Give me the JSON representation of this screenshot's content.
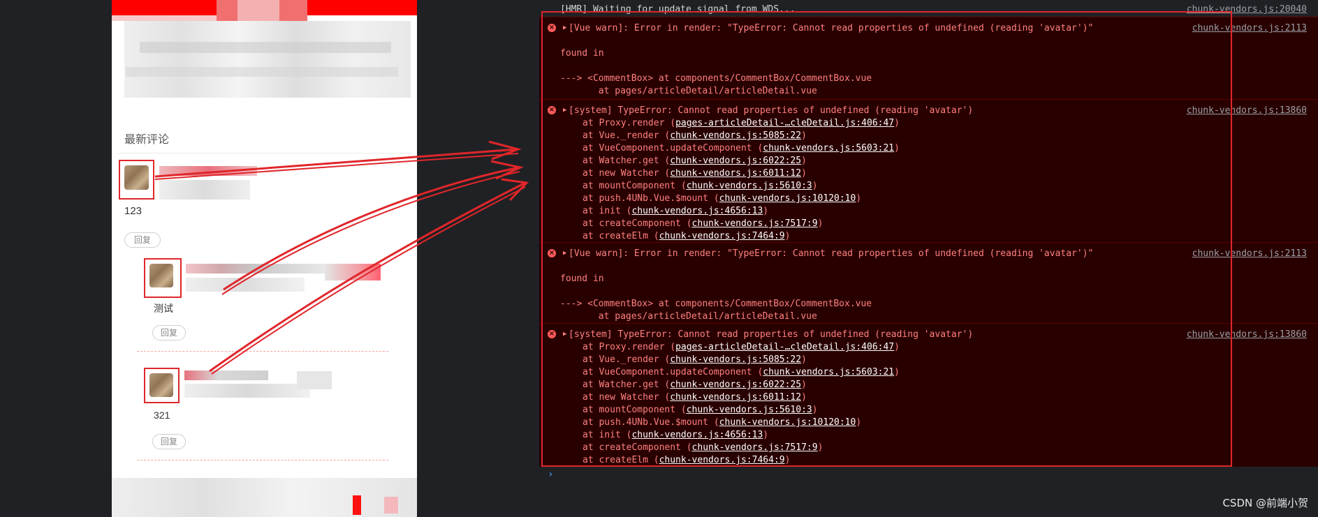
{
  "phone": {
    "section_title": "最新评论",
    "comments": [
      {
        "name": "123",
        "reply_label": "回复"
      },
      {
        "name": "测试",
        "reply_label": "回复"
      },
      {
        "name": "321",
        "reply_label": "回复"
      }
    ]
  },
  "console": {
    "hmr_line": "[HMR] Waiting for update signal from WDS...",
    "hmr_source": "chunk-vendors.js:20040",
    "errors": [
      {
        "kind": "vue",
        "message": "[Vue warn]: Error in render: \"TypeError: Cannot read properties of undefined (reading 'avatar')\"",
        "source": "chunk-vendors.js:2113",
        "found_in": "found in",
        "trace1": "---> <CommentBox> at components/CommentBox/CommentBox.vue",
        "trace2": "       at pages/articleDetail/articleDetail.vue"
      },
      {
        "kind": "system",
        "message": "[system] TypeError: Cannot read properties of undefined (reading 'avatar')",
        "source": "chunk-vendors.js:13860",
        "frames": [
          {
            "fn": "at Proxy.render (",
            "link": "pages-articleDetail-…cleDetail.js:406:47",
            "end": ")"
          },
          {
            "fn": "at Vue._render (",
            "link": "chunk-vendors.js:5085:22",
            "end": ")"
          },
          {
            "fn": "at VueComponent.updateComponent (",
            "link": "chunk-vendors.js:5603:21",
            "end": ")"
          },
          {
            "fn": "at Watcher.get (",
            "link": "chunk-vendors.js:6022:25",
            "end": ")"
          },
          {
            "fn": "at new Watcher (",
            "link": "chunk-vendors.js:6011:12",
            "end": ")"
          },
          {
            "fn": "at mountComponent (",
            "link": "chunk-vendors.js:5610:3",
            "end": ")"
          },
          {
            "fn": "at push.4UNb.Vue.$mount (",
            "link": "chunk-vendors.js:10120:10",
            "end": ")"
          },
          {
            "fn": "at init (",
            "link": "chunk-vendors.js:4656:13",
            "end": ")"
          },
          {
            "fn": "at createComponent (",
            "link": "chunk-vendors.js:7517:9",
            "end": ")"
          },
          {
            "fn": "at createElm (",
            "link": "chunk-vendors.js:7464:9",
            "end": ")"
          }
        ]
      },
      {
        "kind": "vue",
        "message": "[Vue warn]: Error in render: \"TypeError: Cannot read properties of undefined (reading 'avatar')\"",
        "source": "chunk-vendors.js:2113",
        "found_in": "found in",
        "trace1": "---> <CommentBox> at components/CommentBox/CommentBox.vue",
        "trace2": "       at pages/articleDetail/articleDetail.vue"
      },
      {
        "kind": "system",
        "message": "[system] TypeError: Cannot read properties of undefined (reading 'avatar')",
        "source": "chunk-vendors.js:13860",
        "frames": [
          {
            "fn": "at Proxy.render (",
            "link": "pages-articleDetail-…cleDetail.js:406:47",
            "end": ")"
          },
          {
            "fn": "at Vue._render (",
            "link": "chunk-vendors.js:5085:22",
            "end": ")"
          },
          {
            "fn": "at VueComponent.updateComponent (",
            "link": "chunk-vendors.js:5603:21",
            "end": ")"
          },
          {
            "fn": "at Watcher.get (",
            "link": "chunk-vendors.js:6022:25",
            "end": ")"
          },
          {
            "fn": "at new Watcher (",
            "link": "chunk-vendors.js:6011:12",
            "end": ")"
          },
          {
            "fn": "at mountComponent (",
            "link": "chunk-vendors.js:5610:3",
            "end": ")"
          },
          {
            "fn": "at push.4UNb.Vue.$mount (",
            "link": "chunk-vendors.js:10120:10",
            "end": ")"
          },
          {
            "fn": "at init (",
            "link": "chunk-vendors.js:4656:13",
            "end": ")"
          },
          {
            "fn": "at createComponent (",
            "link": "chunk-vendors.js:7517:9",
            "end": ")"
          },
          {
            "fn": "at createElm (",
            "link": "chunk-vendors.js:7464:9",
            "end": ")"
          }
        ]
      }
    ],
    "prompt_symbol": "›"
  },
  "watermark": "CSDN @前端小贺",
  "colors": {
    "error_red": "#ff8080",
    "error_bg": "#290000",
    "annotation_red": "#e0262b",
    "header_red": "#ff0000"
  }
}
